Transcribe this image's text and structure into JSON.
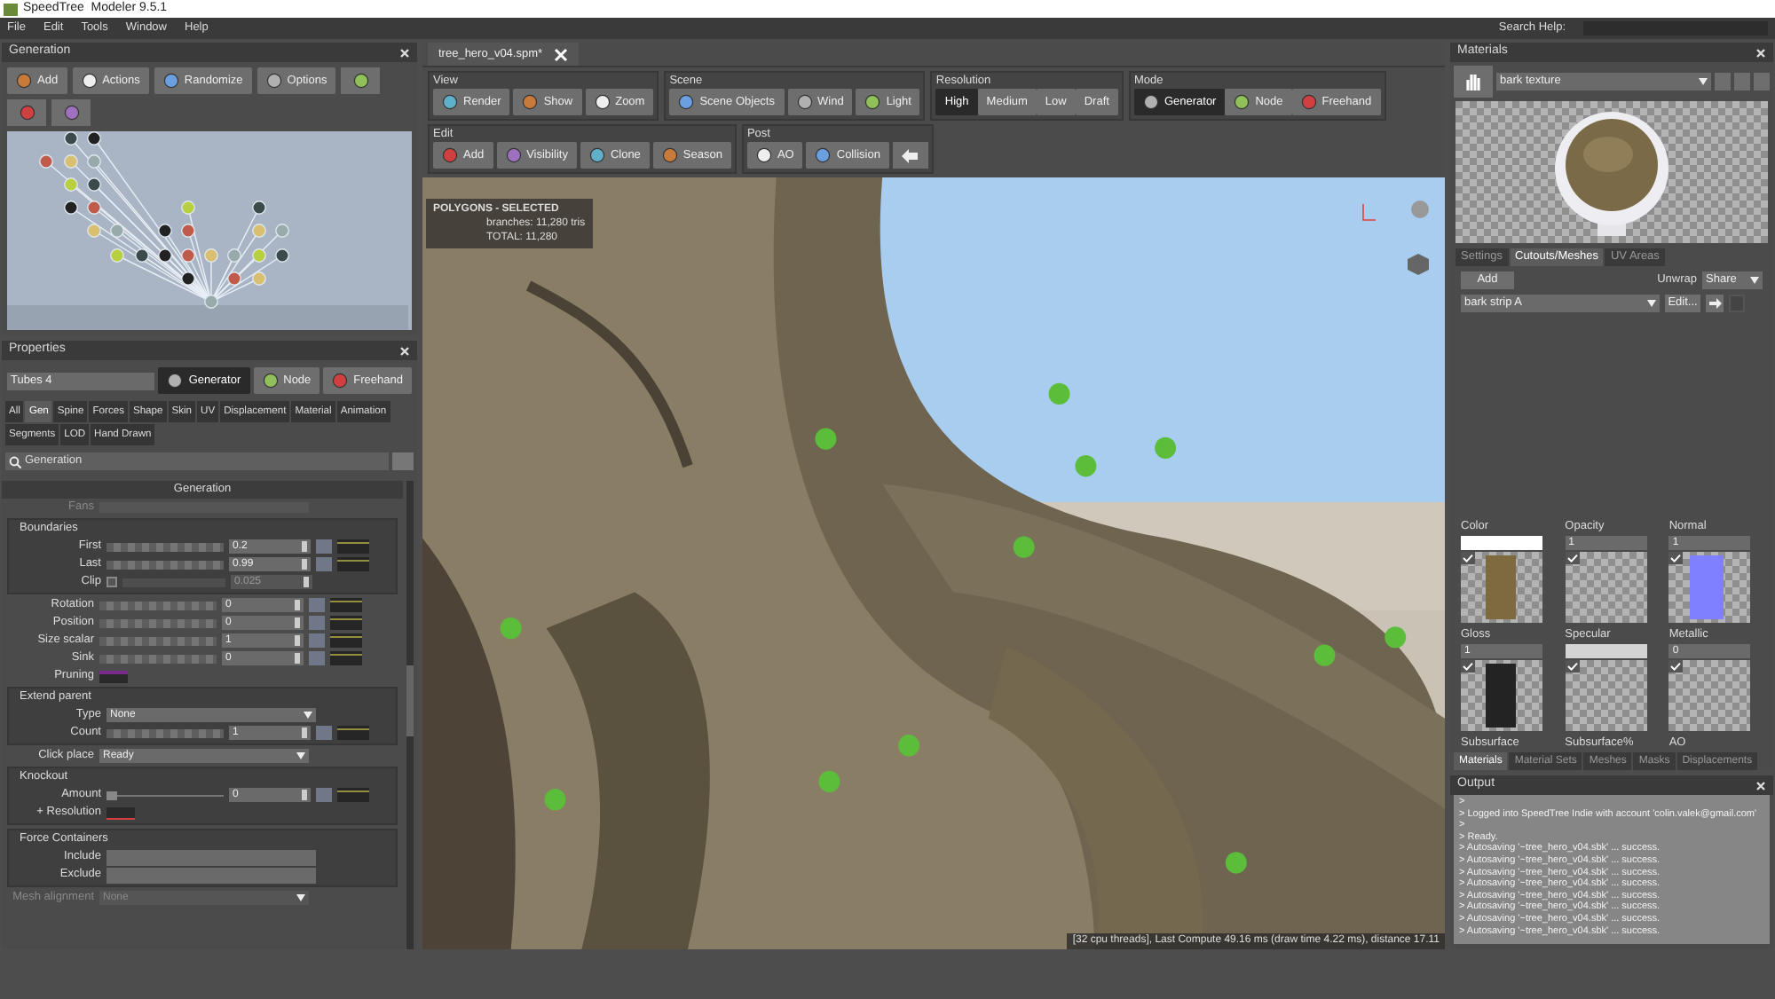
{
  "title_bar": {
    "title": "SpeedTree  Modeler 9.5.1",
    "search_label": "Search Help:"
  },
  "menu": [
    "File",
    "Edit",
    "Tools",
    "Window",
    "Help"
  ],
  "generation": {
    "title": "Generation",
    "buttons": [
      "Add",
      "Actions",
      "Randomize",
      "Options"
    ]
  },
  "properties": {
    "title": "Properties",
    "name_value": "Tubes 4",
    "modes": [
      {
        "label": "Generator",
        "selected": true
      },
      {
        "label": "Node",
        "selected": false
      },
      {
        "label": "Freehand",
        "selected": false
      }
    ],
    "tab_rows": [
      [
        {
          "label": "All",
          "selected": false
        },
        {
          "label": "Gen",
          "selected": true
        },
        {
          "label": "Spine",
          "selected": false
        },
        {
          "label": "Forces",
          "selected": false
        },
        {
          "label": "Shape",
          "selected": false
        },
        {
          "label": "Skin",
          "selected": false
        },
        {
          "label": "UV",
          "selected": false
        },
        {
          "label": "Displacement",
          "selected": false
        },
        {
          "label": "Material",
          "selected": false
        },
        {
          "label": "Animation",
          "selected": false
        }
      ],
      [
        {
          "label": "Segments",
          "selected": false
        },
        {
          "label": "LOD",
          "selected": false
        },
        {
          "label": "Hand Drawn",
          "selected": false
        }
      ]
    ],
    "search_value": "Generation",
    "section": "Generation",
    "rows": [
      {
        "kind": "faded",
        "label": "Fans"
      },
      {
        "kind": "group",
        "title": "Boundaries",
        "rows": [
          {
            "kind": "slider",
            "label": "First",
            "value": "0.2"
          },
          {
            "kind": "slider",
            "label": "Last",
            "value": "0.99"
          },
          {
            "kind": "check_slider",
            "label": "Clip",
            "value": "0.025",
            "checked": false
          }
        ]
      },
      {
        "kind": "slider",
        "label": "Rotation",
        "value": "0"
      },
      {
        "kind": "slider",
        "label": "Position",
        "value": "0"
      },
      {
        "kind": "slider",
        "label": "Size scalar",
        "value": "1"
      },
      {
        "kind": "slider",
        "label": "Sink",
        "value": "0"
      },
      {
        "kind": "swatch",
        "label": "Pruning"
      },
      {
        "kind": "group",
        "title": "Extend parent",
        "rows": [
          {
            "kind": "dropdown",
            "label": "Type",
            "value": "None"
          },
          {
            "kind": "slider",
            "label": "Count",
            "value": "1"
          }
        ]
      },
      {
        "kind": "dropdown",
        "label": "Click place",
        "value": "Ready"
      },
      {
        "kind": "group",
        "title": "Knockout",
        "rows": [
          {
            "kind": "line_slider",
            "label": "Amount",
            "value": "0"
          },
          {
            "kind": "curve",
            "label": "+ Resolution"
          }
        ]
      },
      {
        "kind": "group",
        "title": "Force Containers",
        "rows": [
          {
            "kind": "field",
            "label": "Include"
          },
          {
            "kind": "field",
            "label": "Exclude"
          }
        ]
      },
      {
        "kind": "faded_dropdown",
        "label": "Mesh alignment",
        "value": "None"
      }
    ]
  },
  "document_tab": {
    "label": "tree_hero_v04.spm*"
  },
  "toolbar": {
    "rows": [
      [
        {
          "title": "View",
          "kind": "buttons",
          "buttons": [
            "Render",
            "Show",
            "Zoom"
          ]
        },
        {
          "title": "Scene",
          "kind": "buttons",
          "buttons": [
            "Scene Objects",
            "Wind",
            "Light"
          ]
        },
        {
          "title": "Resolution",
          "kind": "segmented",
          "options": [
            {
              "label": "High",
              "selected": true
            },
            {
              "label": "Medium",
              "selected": false
            },
            {
              "label": "Low",
              "selected": false
            },
            {
              "label": "Draft",
              "selected": false
            }
          ]
        },
        {
          "title": "Mode",
          "kind": "modes",
          "options": [
            {
              "label": "Generator",
              "selected": true
            },
            {
              "label": "Node",
              "selected": false
            },
            {
              "label": "Freehand",
              "selected": false
            }
          ]
        }
      ],
      [
        {
          "title": "Edit",
          "kind": "buttons",
          "buttons": [
            "Add",
            "Visibility",
            "Clone",
            "Season"
          ]
        },
        {
          "title": "Post",
          "kind": "buttons",
          "buttons": [
            "AO",
            "Collision"
          ],
          "arrow_button": true
        }
      ]
    ]
  },
  "viewport": {
    "stats": [
      "POLYGONS - SELECTED",
      "branches: 11,280 tris",
      "TOTAL: 11,280"
    ],
    "status": "[32 cpu threads], Last Compute 49.16 ms (draw time 4.22 ms), distance 17.11"
  },
  "materials": {
    "title": "Materials",
    "material": "bark texture",
    "tabs": [
      {
        "label": "Settings",
        "selected": false
      },
      {
        "label": "Cutouts/Meshes",
        "selected": true
      },
      {
        "label": "UV Areas",
        "selected": false
      }
    ],
    "add": "Add",
    "unwrap_label": "Unwrap",
    "unwrap_value": "Share",
    "mesh": "bark strip A",
    "edit": "Edit...",
    "maps": [
      {
        "label": "Color",
        "kind": "swatch",
        "color": "#ffffff",
        "checked": true,
        "thumbnail": {
          "kind": "bark"
        }
      },
      {
        "label": "Opacity",
        "kind": "number",
        "value": "1",
        "checked": true
      },
      {
        "label": "Normal",
        "kind": "number",
        "value": "1",
        "checked": true,
        "thumbnail": {
          "kind": "normal"
        }
      },
      {
        "label": "Gloss",
        "kind": "number",
        "value": "1",
        "checked": true,
        "thumbnail": {
          "kind": "dark"
        }
      },
      {
        "label": "Specular",
        "kind": "swatch",
        "color": "#d4d4d4",
        "checked": true
      },
      {
        "label": "Metallic",
        "kind": "number",
        "value": "0",
        "checked": true
      }
    ],
    "more_labels": [
      "Subsurface",
      "Subsurface%",
      "AO"
    ],
    "bottom_tabs": [
      {
        "label": "Materials",
        "selected": true
      },
      {
        "label": "Material Sets",
        "selected": false
      },
      {
        "label": "Meshes",
        "selected": false
      },
      {
        "label": "Masks",
        "selected": false
      },
      {
        "label": "Displacements",
        "selected": false
      }
    ]
  },
  "output": {
    "title": "Output",
    "lines": [
      ">",
      "> Logged into SpeedTree Indie with account 'colin.valek@gmail.com'",
      ">",
      "> Ready.",
      "> Autosaving '~tree_hero_v04.sbk' ... success.",
      "> Autosaving '~tree_hero_v04.sbk' ... success.",
      "> Autosaving '~tree_hero_v04.sbk' ... success.",
      "> Autosaving '~tree_hero_v04.sbk' ... success.",
      "> Autosaving '~tree_hero_v04.sbk' ... success.",
      "> Autosaving '~tree_hero_v04.sbk' ... success.",
      "> Autosaving '~tree_hero_v04.sbk' ... success.",
      "> Autosaving '~tree_hero_v04.sbk' ... success."
    ]
  }
}
